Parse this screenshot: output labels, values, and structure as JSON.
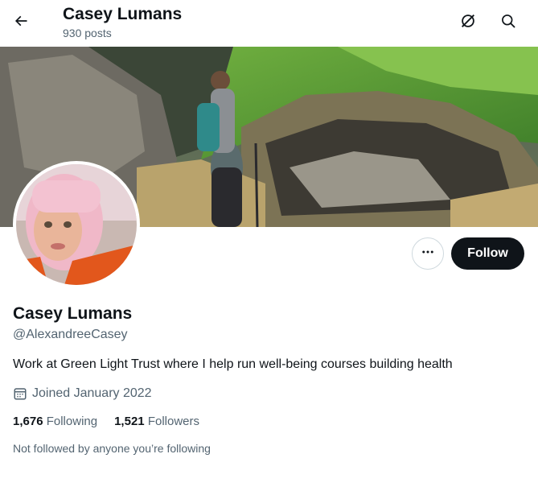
{
  "header": {
    "title": "Casey Lumans",
    "post_count": "930 posts",
    "back_icon": "arrow-left-icon",
    "action_icons": [
      "grok-icon",
      "search-icon"
    ]
  },
  "banner": {
    "description": "hiker on grassy mountain slope"
  },
  "profile": {
    "name": "Casey Lumans",
    "handle": "@AlexandreeCasey",
    "bio": "Work at Green Light Trust where I help run well-being courses building health",
    "joined": "Joined January 2022",
    "following_count": "1,676",
    "following_label": "Following",
    "followers_count": "1,521",
    "followers_label": "Followers",
    "not_followed_text": "Not followed by anyone you’re following"
  },
  "actions": {
    "more_icon": "more-horizontal-icon",
    "follow_label": "Follow"
  },
  "colors": {
    "primary_text": "#0f1419",
    "secondary_text": "#536471",
    "follow_bg": "#0f1419",
    "border": "#cfd9de"
  }
}
